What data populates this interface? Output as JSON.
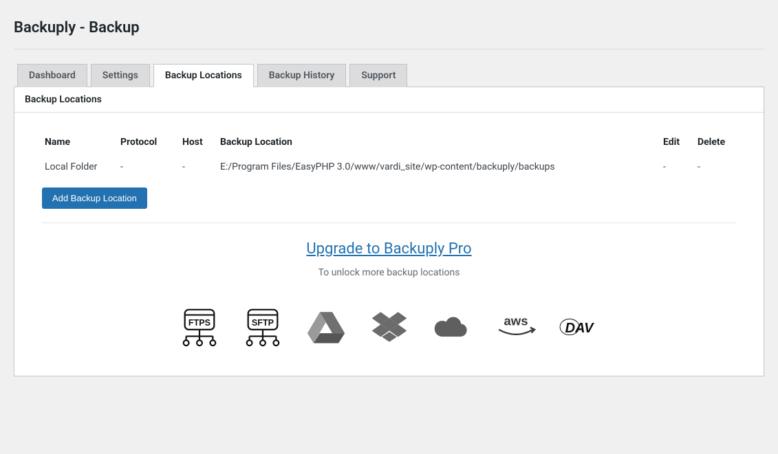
{
  "header": {
    "title": "Backuply - Backup"
  },
  "tabs": [
    {
      "label": "Dashboard"
    },
    {
      "label": "Settings"
    },
    {
      "label": "Backup Locations"
    },
    {
      "label": "Backup History"
    },
    {
      "label": "Support"
    }
  ],
  "panel": {
    "title": "Backup Locations",
    "columns": {
      "name": "Name",
      "protocol": "Protocol",
      "host": "Host",
      "path": "Backup Location",
      "edit": "Edit",
      "delete": "Delete"
    },
    "rows": [
      {
        "name": "Local Folder",
        "protocol": "-",
        "host": "-",
        "path": "E:/Program Files/EasyPHP 3.0/www/vardi_site/wp-content/backuply/backups",
        "edit": "-",
        "delete": "-"
      }
    ],
    "add_button": "Add Backup Location"
  },
  "upgrade": {
    "link_text": "Upgrade to Backuply Pro",
    "subtitle": "To unlock more backup locations"
  },
  "pro_icons": {
    "ftps": "FTPS",
    "sftp": "SFTP",
    "aws": "aws",
    "dav": "DAV"
  }
}
